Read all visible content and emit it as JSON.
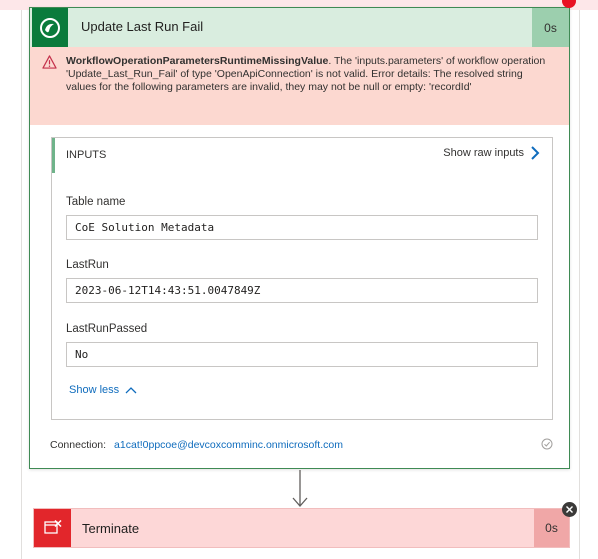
{
  "action": {
    "title": "Update Last Run Fail",
    "duration": "0s",
    "status": "failed",
    "icon": "dataverse-icon",
    "accent_color": "#0a7b3c"
  },
  "error": {
    "code": "WorkflowOperationParametersRuntimeMissingValue",
    "message": ". The 'inputs.parameters' of workflow operation 'Update_Last_Run_Fail' of type 'OpenApiConnection' is not valid. Error details: The resolved string values for the following parameters are invalid, they may not be null or empty: 'recordId'",
    "icon": "warning-icon"
  },
  "inputs": {
    "header": "INPUTS",
    "raw_link": "Show raw inputs",
    "fields": [
      {
        "label": "Table name",
        "value": "CoE Solution Metadata"
      },
      {
        "label": "LastRun",
        "value": "2023-06-12T14:43:51.0047849Z"
      },
      {
        "label": "LastRunPassed",
        "value": "No"
      }
    ],
    "toggle": "Show less"
  },
  "connection": {
    "label": "Connection:",
    "value": "a1cat!0ppcoe@devcoxcomminc.onmicrosoft.com"
  },
  "next_action": {
    "title": "Terminate",
    "duration": "0s",
    "icon": "terminate-icon",
    "accent_color": "#e2262b"
  }
}
